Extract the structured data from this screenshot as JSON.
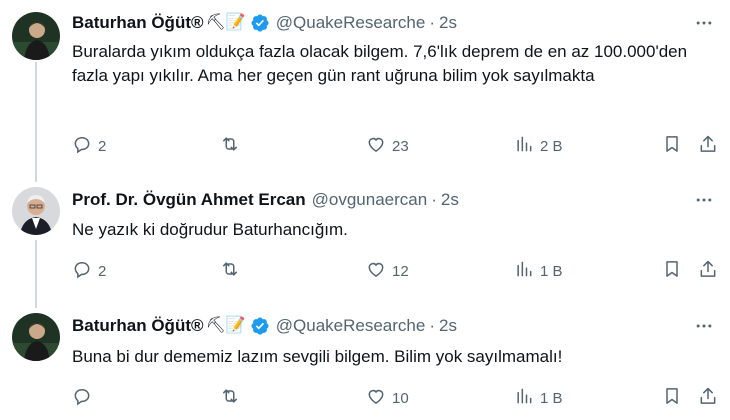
{
  "tweets": [
    {
      "name": "Baturhan Öğüt®",
      "emojis": "⛏📝",
      "handle": "@QuakeResearche",
      "separator": "·",
      "time": "2s",
      "text": "Buralarda yıkım oldukça fazla olacak bilgem. 7,6'lık deprem de en az 100.000'den fazla yapı yıkılır. Ama her geçen gün rant uğruna bilim yok sayılmakta",
      "replies": "2",
      "retweets": "",
      "likes": "23",
      "views": "2 B"
    },
    {
      "name": "Prof. Dr. Övgün Ahmet Ercan",
      "emojis": "",
      "handle": "@ovgunaercan",
      "separator": "·",
      "time": "2s",
      "text": "Ne yazık ki doğrudur Baturhancığım.",
      "replies": "2",
      "retweets": "",
      "likes": "12",
      "views": "1 B"
    },
    {
      "name": "Baturhan Öğüt®",
      "emojis": "⛏📝",
      "handle": "@QuakeResearche",
      "separator": "·",
      "time": "2s",
      "text": "Buna bi dur dememiz lazım sevgili bilgem. Bilim yok sayılmamalı!",
      "replies": "",
      "retweets": "",
      "likes": "10",
      "views": "1 B"
    }
  ],
  "icons": {
    "reply": "reply-icon",
    "retweet": "retweet-icon",
    "like": "heart-icon",
    "views": "views-icon",
    "bookmark": "bookmark-icon",
    "share": "share-icon",
    "more": "more-icon",
    "verified": "verified-badge-icon"
  },
  "colors": {
    "text": "#0f1419",
    "secondary": "#536471",
    "verified": "#1d9bf0",
    "thread_line": "#cfd9de"
  }
}
